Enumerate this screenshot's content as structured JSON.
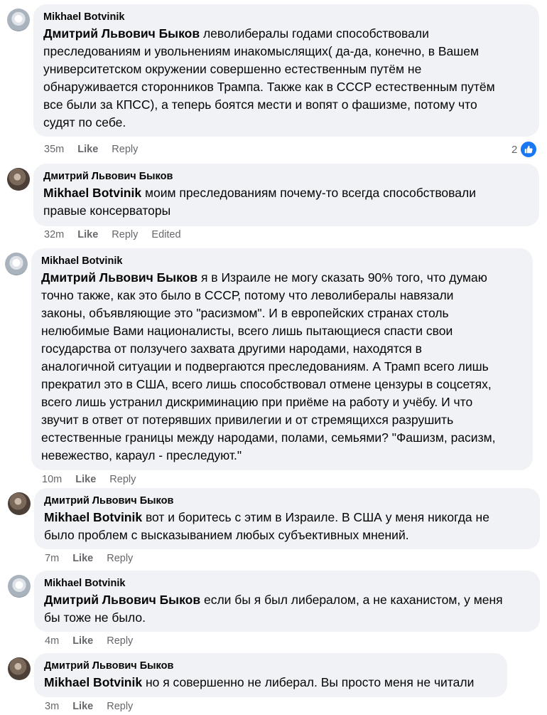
{
  "comments": [
    {
      "author": "Mikhael Botvinik",
      "mention": "Дмитрий Львович Быков",
      "lines": [
        " леволибералы годами способствовали",
        "преследованиям и увольнениям инакомыслящих( да-да, конечно, в Вашем",
        "университетском окружении совершенно естественным путём не",
        "обнаруживается сторонников Трампа. Также как в СССР естественным путём",
        "все были за КПСС), а теперь боятся мести и вопят о фашизме, потому что",
        "судят по себе."
      ],
      "time": "35m",
      "like": "Like",
      "reply": "Reply",
      "reaction_count": "2"
    },
    {
      "author": "Дмитрий Львович Быков",
      "mention": "Mikhael Botvinik",
      "lines": [
        " моим преследованиям почему-то всегда способствовали",
        "правые консерваторы"
      ],
      "time": "32m",
      "like": "Like",
      "reply": "Reply",
      "edited": "Edited"
    },
    {
      "author": "Mikhael Botvinik",
      "mention": "Дмитрий Львович Быков",
      "lines": [
        " я в Израиле не могу сказать 90% того, что думаю",
        "точно также, как это было в СССР, потому что леволибералы навязали",
        "законы, объявляющие это \"расизмом\". И в европейских странах столь",
        "нелюбимые Вами националисты, всего лишь пытающиеся спасти свои",
        "государства от ползучего захвата другими народами, находятся в",
        "аналогичной ситуации и подвергаются преследованиям. А Трамп всего лишь",
        "прекратил это в США, всего лишь способствовал отмене цензуры в соцсетях,",
        "всего лишь устранил дискриминацию при приёме на работу и учёбу. И что",
        "звучит в ответ от потерявших привилегии и от стремящихся разрушить",
        "естественные границы между народами, полами, семьями? \"Фашизм, расизм,",
        "невежество, караул - преследуют.\""
      ],
      "time": "10m",
      "like": "Like",
      "reply": "Reply"
    },
    {
      "author": "Дмитрий Львович Быков",
      "mention": "Mikhael Botvinik",
      "lines": [
        " вот и боритесь с этим в Израиле. В США у меня никогда не",
        "было проблем с высказыванием любых субъективных мнений."
      ],
      "time": "7m",
      "like": "Like",
      "reply": "Reply"
    },
    {
      "author": "Mikhael Botvinik",
      "mention": "Дмитрий Львович Быков",
      "lines": [
        " если бы я был либералом, а не каханистом, у меня",
        "бы тоже не было."
      ],
      "time": "4m",
      "like": "Like",
      "reply": "Reply"
    },
    {
      "author": "Дмитрий Львович Быков",
      "mention": "Mikhael Botvinik",
      "lines": [
        " но я совершенно не либерал. Вы просто меня не читали"
      ],
      "time": "3m",
      "like": "Like",
      "reply": "Reply"
    }
  ],
  "icons": {
    "like_reaction": "thumbs-up-icon",
    "accent": "#1877f2"
  }
}
